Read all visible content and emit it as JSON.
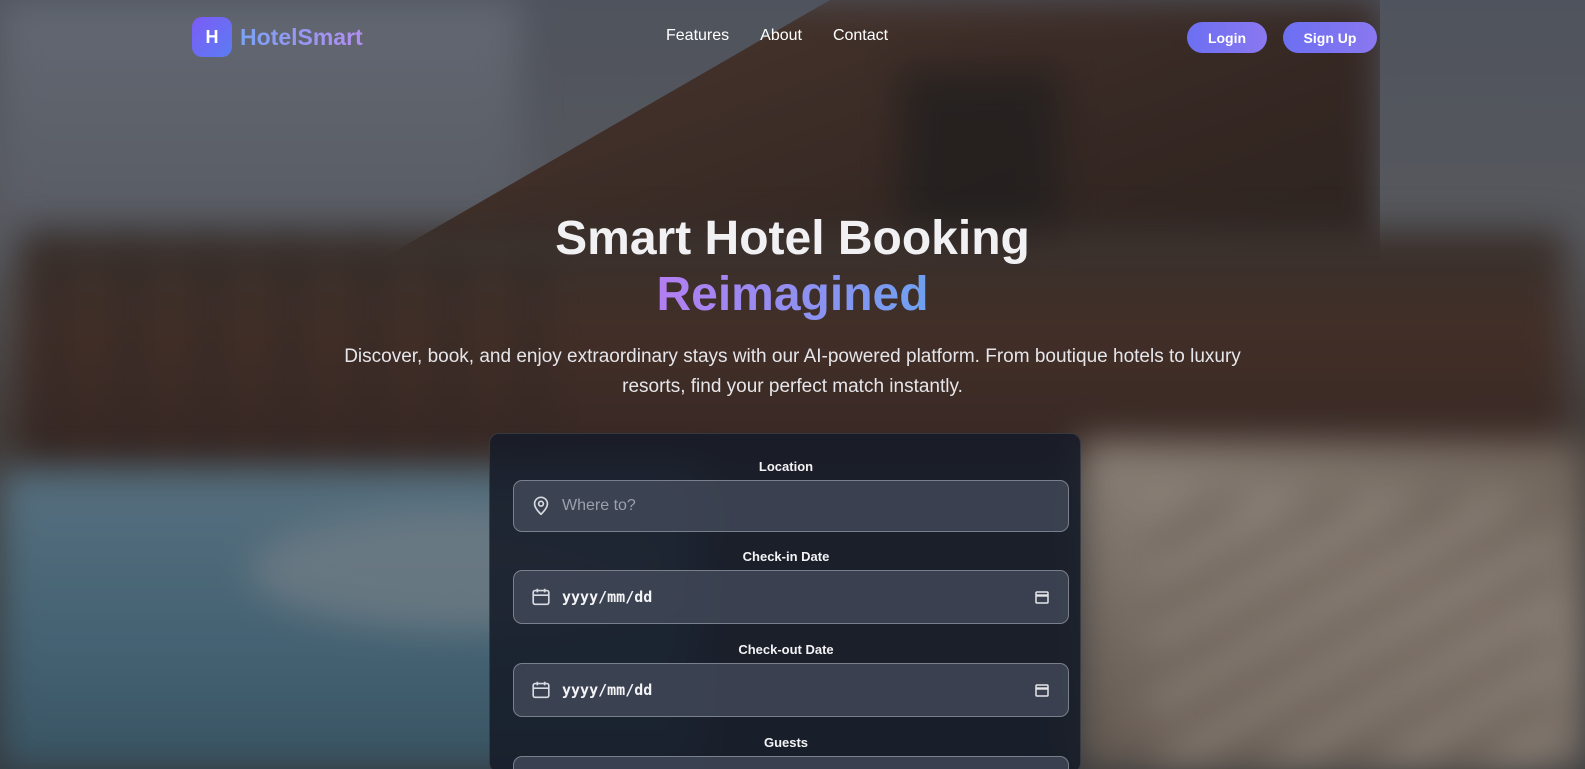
{
  "brand": {
    "badge": "H",
    "name": "HotelSmart",
    "accent": "#7c5cf6"
  },
  "nav": {
    "items": [
      {
        "label": "Features"
      },
      {
        "label": "About"
      },
      {
        "label": "Contact"
      }
    ]
  },
  "auth": {
    "login_label": "Login",
    "signup_label": "Sign Up"
  },
  "hero": {
    "title": "Smart Hotel Booking",
    "accent": "Reimagined",
    "subtitle": "Discover, book, and enjoy extraordinary stays with our AI-powered platform. From boutique hotels to luxury resorts, find your perfect match instantly."
  },
  "booking": {
    "location": {
      "label": "Location",
      "placeholder": "Where to?",
      "icon": "map-pin-icon"
    },
    "checkin": {
      "label": "Check-in Date",
      "value": "yyyy/mm/dd",
      "icon": "calendar-icon"
    },
    "checkout": {
      "label": "Check-out Date",
      "value": "yyyy/mm/dd",
      "icon": "calendar-icon"
    },
    "guests": {
      "label": "Guests"
    }
  }
}
